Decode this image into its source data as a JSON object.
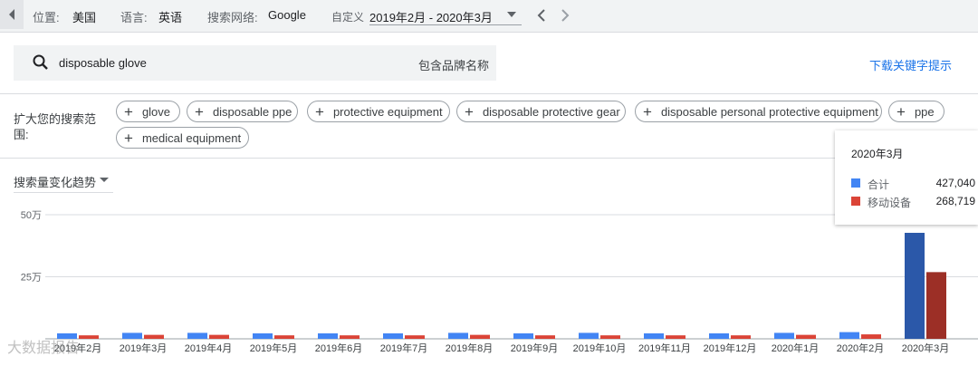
{
  "topbar": {
    "location_label": "位置:",
    "location_value": "美国",
    "language_label": "语言:",
    "language_value": "英语",
    "network_label": "搜索网络:",
    "network_value": "Google",
    "custom_label": "自定义",
    "date_range": "2019年2月 - 2020年3月"
  },
  "search": {
    "query": "disposable glove",
    "brand_option": "包含品牌名称",
    "download_link": "下载关键字提示"
  },
  "expand": {
    "label": "扩大您的搜索范围:",
    "chips": [
      "glove",
      "disposable ppe",
      "protective equipment",
      "disposable protective gear",
      "disposable personal protective equipment",
      "ppe",
      "medical equipment"
    ]
  },
  "trend_select": "搜索量变化趋势",
  "tooltip": {
    "title": "2020年3月",
    "rows": [
      {
        "name": "合计",
        "value": "427,040"
      },
      {
        "name": "移动设备",
        "value": "268,719"
      }
    ]
  },
  "watermark": "大数据报告",
  "colors": {
    "total": "#4285f4",
    "mobile": "#db4437",
    "total_highlight": "#2b58a9",
    "mobile_highlight": "#9c2f26",
    "link": "#1a73e8"
  },
  "chart_data": {
    "type": "bar",
    "categories": [
      "2019年2月",
      "2019年3月",
      "2019年4月",
      "2019年5月",
      "2019年6月",
      "2019年7月",
      "2019年8月",
      "2019年9月",
      "2019年10月",
      "2019年11月",
      "2019年12月",
      "2020年1月",
      "2020年2月",
      "2020年3月"
    ],
    "series": [
      {
        "name": "合计",
        "values": [
          22000,
          24000,
          24000,
          22000,
          22000,
          22000,
          24000,
          22000,
          24000,
          22000,
          22000,
          24000,
          27000,
          427040
        ]
      },
      {
        "name": "移动设备",
        "values": [
          14000,
          16000,
          16000,
          14000,
          14000,
          14000,
          16000,
          14000,
          14000,
          14000,
          14000,
          16000,
          18000,
          268719
        ]
      }
    ],
    "yticks": [
      {
        "value": 250000,
        "label": "25万"
      },
      {
        "value": 500000,
        "label": "50万"
      }
    ],
    "ylim": [
      0,
      500000
    ],
    "grid": true,
    "legend": "tooltip"
  }
}
